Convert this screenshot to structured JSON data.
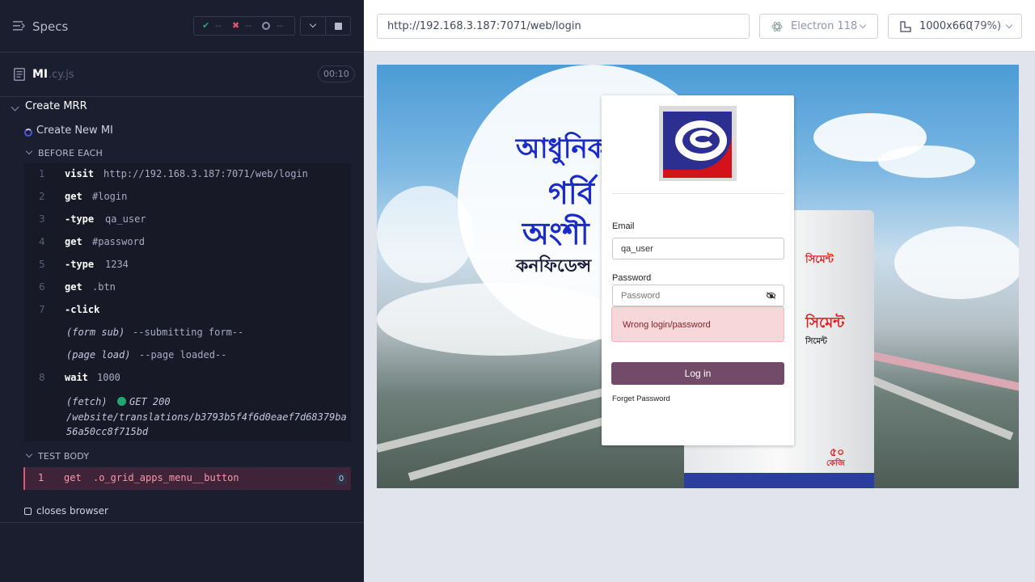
{
  "reporter": {
    "header": {
      "title": "Specs",
      "passed": "--",
      "failed": "--",
      "pending": "--",
      "pass_icon": "✔",
      "fail_icon": "✖"
    },
    "spec_file": {
      "name": "MI",
      "ext": ".cy.js",
      "duration": "00:10"
    },
    "suite": {
      "title": "Create MRR"
    },
    "test": {
      "title": "Create New MI"
    },
    "before_each": {
      "label": "BEFORE EACH",
      "commands": [
        {
          "num": "1",
          "name": "visit",
          "message": "http://192.168.3.187:7071/web/login"
        },
        {
          "num": "2",
          "name": "get",
          "message": "#login"
        },
        {
          "num": "3",
          "name": "-type",
          "message": "qa_user"
        },
        {
          "num": "4",
          "name": "get",
          "message": "#password"
        },
        {
          "num": "5",
          "name": "-type",
          "message": "1234"
        },
        {
          "num": "6",
          "name": "get",
          "message": ".btn"
        },
        {
          "num": "7",
          "name": "-click",
          "message": ""
        }
      ],
      "events": [
        {
          "name": "(form sub)",
          "message": "--submitting form--"
        },
        {
          "name": "(page load)",
          "message": "--page loaded--"
        }
      ],
      "wait": {
        "num": "8",
        "name": "wait",
        "message": "1000"
      },
      "fetch": {
        "name": "(fetch)",
        "status": "GET 200",
        "url_line1": "/website/translations/b3793b5f4f6d0eaef7d68379ba",
        "url_line2": "56a50cc8f715bd"
      }
    },
    "test_body": {
      "label": "TEST BODY",
      "commands": [
        {
          "num": "1",
          "name": "get",
          "message": ".o_grid_apps_menu__button",
          "count": "0"
        }
      ]
    },
    "after": {
      "label": "closes browser"
    }
  },
  "aut_header": {
    "url": "http://192.168.3.187:7071/web/login",
    "browser": "Electron 118",
    "viewport": "1000x660",
    "scale": "(79%)"
  },
  "banner": {
    "line1": "আধুনিক",
    "line2": "গর্বি",
    "line3": "অংশী",
    "line4": "কনফিডেন্স",
    "bag_line1": "সিমেন্ট",
    "bag_line2": "সিমেন্ট",
    "bag_weight": "৫০",
    "bag_unit": "কেজি",
    "bag_top": "সিমেন্ট"
  },
  "login_form": {
    "email_label": "Email",
    "email_value": "qa_user",
    "password_label": "Password",
    "password_placeholder": "Password",
    "error": "Wrong login/password",
    "submit": "Log in",
    "forget": "Forget Password"
  },
  "colors": {
    "reporter_bg": "#1b1e2e",
    "fail_row_bg": "#3e2339",
    "login_button": "#714b67",
    "alert_bg": "#f8d7da"
  }
}
